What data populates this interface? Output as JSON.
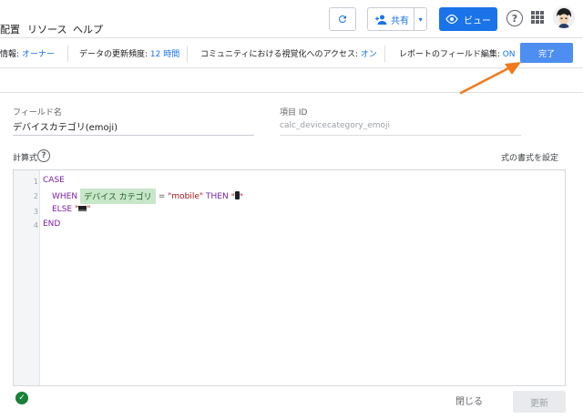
{
  "menu": {
    "item1": "配置",
    "item2": "リソース",
    "item3": "ヘルプ"
  },
  "toolbar": {
    "share_label": "共有",
    "view_label": "ビュー",
    "help_glyph": "?"
  },
  "info": {
    "data_label": "情報: ",
    "data_value": "オーナー",
    "freshness_label": "データの更新頻度: ",
    "freshness_value": "12 時間",
    "community_label": "コミュニティにおける視覚化へのアクセス: ",
    "community_value": "オン",
    "field_edit_label": "レポートのフィールド編集: ",
    "field_edit_value": "ON",
    "done_label": "完了"
  },
  "form": {
    "field_name_label": "フィールド名",
    "field_name_value": "デバイスカテゴリ(emoji)",
    "item_id_label": "項目 ID",
    "item_id_value": "calc_devicecategory_emoji",
    "formula_label": "計算式",
    "format_link": "式の書式を設定"
  },
  "editor": {
    "line_numbers": [
      "1",
      "2",
      "3",
      "4"
    ],
    "line1": "CASE",
    "when": "WHEN",
    "dimension_chip": "デバイス カテゴリ",
    "eq": "=",
    "mobile_str": "\"mobile\"",
    "then": "THEN",
    "quote_open": "\"",
    "quote_close": "\"",
    "else": "ELSE",
    "line4": "END"
  },
  "footer": {
    "close_label": "閉じる",
    "update_label": "更新"
  },
  "colors": {
    "primary": "#1a73e8",
    "done_button": "#4d8ef0",
    "annotation_arrow": "#f07b1e",
    "valid": "#188038"
  }
}
